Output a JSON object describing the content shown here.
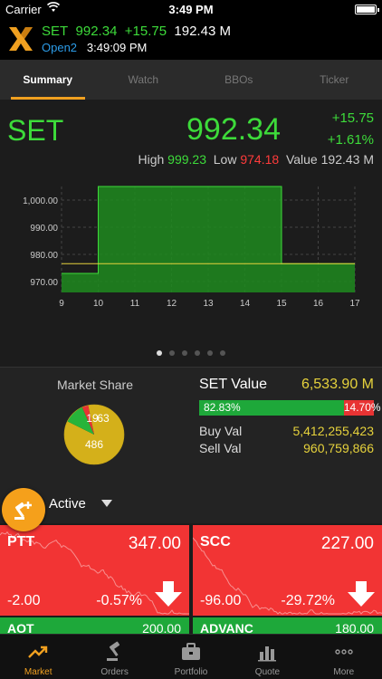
{
  "status_bar": {
    "carrier": "Carrier",
    "time": "3:49 PM"
  },
  "ticker_header": {
    "symbol": "SET",
    "last": "992.34",
    "change": "+15.75",
    "value": "192.43 M",
    "session": "Open2",
    "time": "3:49:09 PM"
  },
  "tabs": [
    {
      "label": "Summary"
    },
    {
      "label": "Watch"
    },
    {
      "label": "BBOs"
    },
    {
      "label": "Ticker"
    }
  ],
  "summary": {
    "symbol": "SET",
    "last": "992.34",
    "change": "+15.75",
    "percent": "+1.61%",
    "high_label": "High",
    "high": "999.23",
    "low_label": "Low",
    "low": "974.18",
    "value_label": "Value",
    "value": "192.43 M"
  },
  "chart_data": {
    "type": "area",
    "x_ticks": [
      "9",
      "10",
      "11",
      "12",
      "13",
      "14",
      "15",
      "16",
      "17"
    ],
    "y_ticks": [
      "970.00",
      "980.00",
      "990.00",
      "1,000.00"
    ],
    "ylim": [
      966,
      1005
    ],
    "xlim": [
      9,
      17
    ],
    "baseline": 976.59,
    "series": [
      {
        "values": [
          [
            9,
            973.0
          ],
          [
            10,
            973.0
          ],
          [
            10,
            1005
          ],
          [
            15,
            1005
          ],
          [
            15,
            976.6
          ],
          [
            17,
            976.6
          ]
        ]
      }
    ],
    "grid": true
  },
  "pager": {
    "pages": 6,
    "current": 0
  },
  "market_share": {
    "title": "Market Share",
    "slices": [
      {
        "label": "486",
        "value": 486,
        "color": "#d4b01a"
      },
      {
        "label": "63",
        "value": 63,
        "color": "#27b43a"
      },
      {
        "label": "19",
        "value": 19,
        "color": "#e83333"
      }
    ]
  },
  "set_value": {
    "title": "SET Value",
    "value": "6,533.90 M",
    "buy_pct": "82.83%",
    "sell_pct": "14.70%",
    "buy_fraction": 0.8283,
    "buy_label": "Buy Val",
    "buy_value": "5,412,255,423",
    "sell_label": "Sell Val",
    "sell_value": "960,759,866"
  },
  "filter": {
    "selected": "Active"
  },
  "tiles": [
    {
      "name": "PTT",
      "price": "347.00",
      "change": "-2.00",
      "percent": "-0.57%"
    },
    {
      "name": "SCC",
      "price": "227.00",
      "change": "-96.00",
      "percent": "-29.72%"
    }
  ],
  "tiles_row2": [
    {
      "name": "AOT",
      "price": "200.00"
    },
    {
      "name": "ADVANC",
      "price": "180.00"
    }
  ],
  "tab_bar": [
    {
      "label": "Market",
      "icon": "trend-up-icon"
    },
    {
      "label": "Orders",
      "icon": "gavel-icon"
    },
    {
      "label": "Portfolio",
      "icon": "briefcase-icon"
    },
    {
      "label": "Quote",
      "icon": "bar-chart-icon"
    },
    {
      "label": "More",
      "icon": "ellipsis-icon"
    }
  ],
  "colors": {
    "up": "#3ddb3a",
    "down": "#ff3b3b",
    "accent": "#f0a020",
    "value": "#e6d23c",
    "session": "#2c9ce8"
  }
}
